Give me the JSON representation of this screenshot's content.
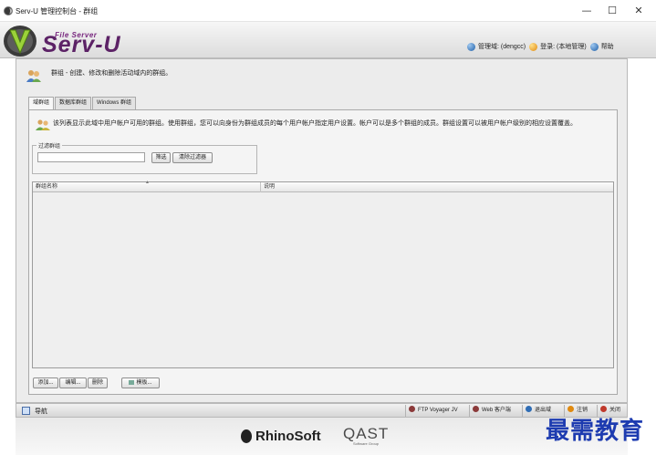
{
  "window": {
    "title": "Serv-U 管理控制台 - 群组",
    "minimize_glyph": "—",
    "maximize_glyph": "☐",
    "close_glyph": "✕"
  },
  "brand": {
    "logo_small": "File Server",
    "logo_big": "Serv-U",
    "primary_color": "#5c2266"
  },
  "header_links": {
    "admin_label": "管理域: (dengcc)",
    "logout_label": "登录: (本地管理)",
    "help_label": "帮助"
  },
  "page": {
    "description": "群组 - 创建、修改和删除活动域内的群组。"
  },
  "tabs": [
    {
      "label": "域群组",
      "active": true
    },
    {
      "label": "数据库群组",
      "active": false
    },
    {
      "label": "Windows 群组",
      "active": false
    }
  ],
  "info": {
    "text": "该列表显示此域中用户帐户可用的群组。使用群组，您可以向身份为群组成员的每个用户帐户指定用户设置。帐户可以是多个群组的成员。群组设置可以被用户帐户级别的相应设置覆盖。"
  },
  "filter": {
    "legend": "过滤群组",
    "input_value": "",
    "filter_button": "筛选",
    "clear_button": "清除过滤器"
  },
  "grid": {
    "columns": [
      "群组名称",
      "说明"
    ],
    "sort_mark": "▲",
    "rows": []
  },
  "actions": {
    "add": "添加...",
    "edit": "编辑...",
    "delete": "删除",
    "template": "模板..."
  },
  "statusbar": {
    "nav_label": "导航",
    "items": [
      {
        "label": "FTP Voyager JV",
        "color": "#8b3a3a"
      },
      {
        "label": "Web 客户端",
        "color": "#8b3a3a"
      },
      {
        "label": "退出域",
        "color": "#2f6db5"
      },
      {
        "label": "注销",
        "color": "#e08a10"
      },
      {
        "label": "关闭",
        "color": "#c0392b"
      }
    ]
  },
  "footer": {
    "rhinosoft": "RhinoSoft",
    "qast": "QAST",
    "qast_sub": "Software Group"
  },
  "watermark": "最需教育"
}
